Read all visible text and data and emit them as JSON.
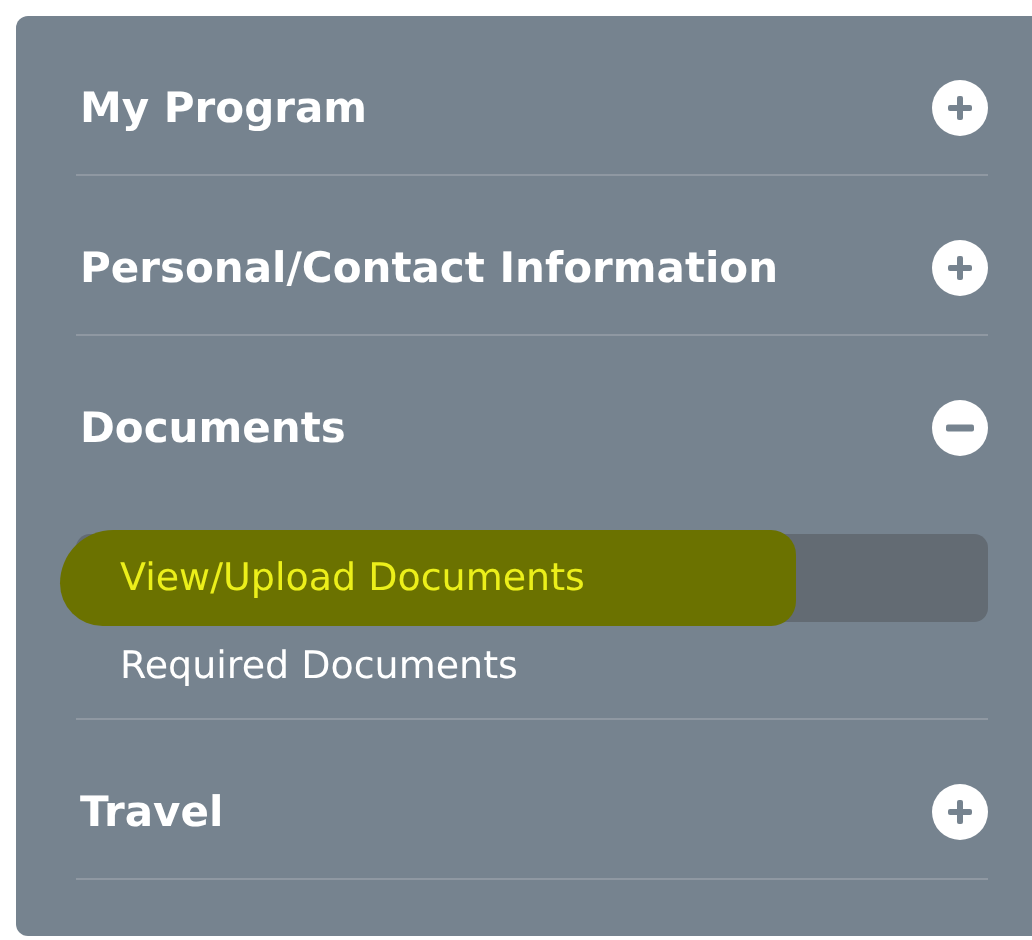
{
  "sections": [
    {
      "title": "My Program",
      "expanded": false
    },
    {
      "title": "Personal/Contact Information",
      "expanded": false
    },
    {
      "title": "Documents",
      "expanded": true,
      "items": [
        {
          "label": "View/Upload Documents",
          "selected": true,
          "highlighted": true
        },
        {
          "label": "Required Documents",
          "selected": false,
          "highlighted": false
        }
      ]
    },
    {
      "title": "Travel",
      "expanded": false
    }
  ]
}
